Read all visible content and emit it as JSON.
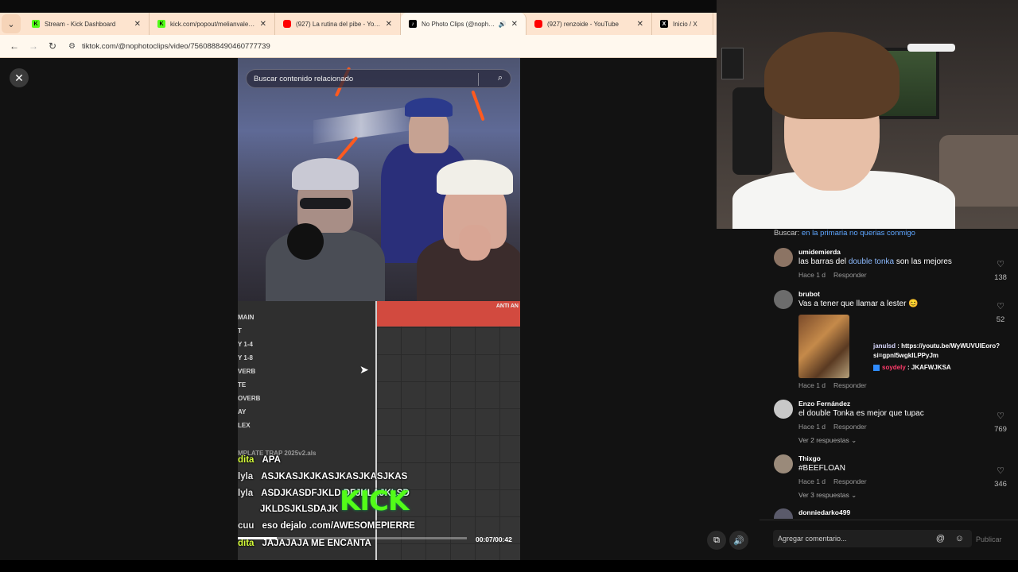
{
  "browser": {
    "tabs": [
      {
        "favicon": "kick",
        "title": "Stream - Kick Dashboard"
      },
      {
        "favicon": "kick",
        "title": "kick.com/popout/melianvalen/..."
      },
      {
        "favicon": "youtube",
        "title": "(927) La rutina del pibe - YouTu..."
      },
      {
        "favicon": "tiktok",
        "title": "No Photo Clips (@nophoto...",
        "active": true,
        "audio": true
      },
      {
        "favicon": "youtube",
        "title": "(927) renzoide - YouTube"
      },
      {
        "favicon": "x",
        "title": "Inicio / X"
      }
    ],
    "url": "tiktok.com/@nophotoclips/video/7560888490460777739"
  },
  "video": {
    "search_placeholder": "Buscar contenido relacionado",
    "daw_clip_label": "ANTI AN",
    "tracks": [
      "MAIN",
      "T",
      "Y 1-4",
      "Y 1-8",
      "VERB",
      "TE",
      "OVERB",
      "AY",
      "LEX"
    ],
    "project_file": "MPLATE TRAP 2025v2.als",
    "time": "00:07/00:42",
    "progress": 0.17,
    "kick_logo": "KICK",
    "chat": [
      {
        "user": "dita",
        "text": "APA"
      },
      {
        "user": "lyla",
        "text": "ASJKASJKJKASJKASJKASJKAS"
      },
      {
        "user": "lyla",
        "text": "ASDJKASDFJKLD                DFJKLAJKLSD"
      },
      {
        "user": "",
        "text": "JKLDSJKLSDAJK"
      },
      {
        "user": "cuu",
        "text": "eso dejalo     .com/AWESOMEPIERRE"
      },
      {
        "user": "dita",
        "text": "JAJAJAJA ME ENCANTA"
      }
    ]
  },
  "comments": {
    "search_label": "Buscar:",
    "search_query": "en la primaria no querias conmigo",
    "items": [
      {
        "user": "umidemierda",
        "text_before": "las barras del ",
        "highlight": "double tonka",
        "text_after": " son las mejores",
        "time": "Hace 1 d",
        "reply": "Responder",
        "likes": "138"
      },
      {
        "user": "brubot",
        "text_before": "Vas a tener que llamar a lester 😊",
        "highlight": "",
        "text_after": "",
        "time": "Hace 1 d",
        "reply": "Responder",
        "likes": "52"
      },
      {
        "user": "Enzo Fernández",
        "text_before": "el double Tonka es mejor que tupac",
        "highlight": "",
        "text_after": "",
        "time": "Hace 1 d",
        "reply": "Responder",
        "likes": "769",
        "replies": "Ver 2 respuestas"
      },
      {
        "user": "Thixgo",
        "text_before": "#BEEFLOAN",
        "highlight": "",
        "text_after": "",
        "time": "Hace 1 d",
        "reply": "Responder",
        "likes": "346",
        "replies": "Ver 3 respuestas"
      },
      {
        "user": "donniedarko499",
        "text_before": "",
        "highlight": "",
        "text_after": ""
      }
    ],
    "overlay_chat": {
      "user1": "janulsd",
      "msg1": "https://youtu.be/WyWUVUlEoro?si=gpnI5wgkILPPyJm",
      "user2": "soydely",
      "msg2": "JKAFWJKSA"
    },
    "add_comment_placeholder": "Agregar comentario...",
    "publish_label": "Publicar"
  }
}
